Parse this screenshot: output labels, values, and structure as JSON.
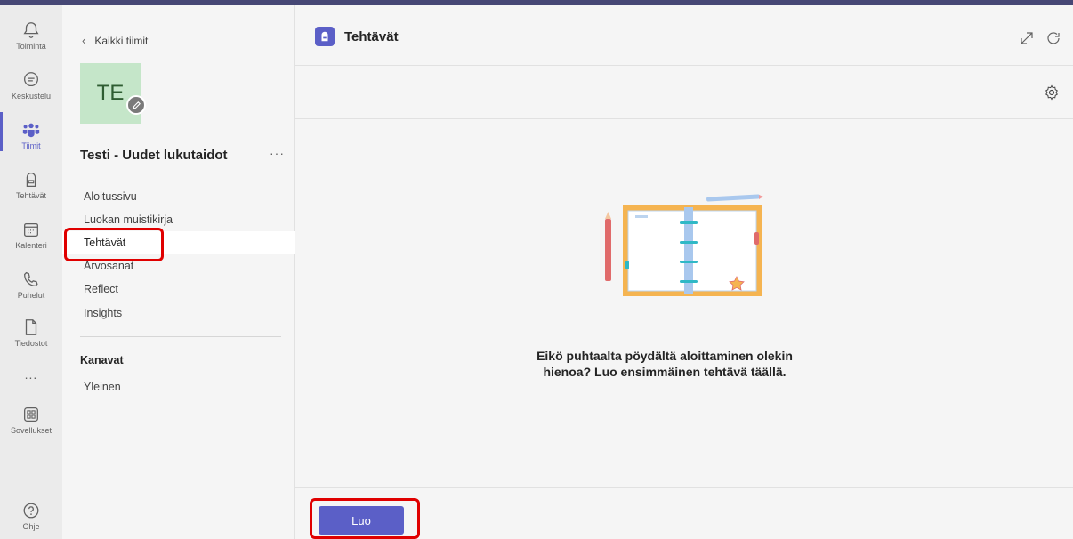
{
  "rail": {
    "items": [
      {
        "label": "Toiminta",
        "icon": "bell-icon"
      },
      {
        "label": "Keskustelu",
        "icon": "chat-icon"
      },
      {
        "label": "Tiimit",
        "icon": "teams-icon"
      },
      {
        "label": "Tehtävät",
        "icon": "backpack-icon"
      },
      {
        "label": "Kalenteri",
        "icon": "calendar-icon"
      },
      {
        "label": "Puhelut",
        "icon": "phone-icon"
      },
      {
        "label": "Tiedostot",
        "icon": "file-icon"
      },
      {
        "label": "...",
        "icon": "more-icon"
      },
      {
        "label": "Sovellukset",
        "icon": "apps-icon"
      }
    ],
    "help_label": "Ohje",
    "active_color": "#5b5fc7"
  },
  "panel": {
    "back_label": "Kaikki tiimit",
    "avatar_initials": "TE",
    "avatar_color": "#c5e6c9",
    "team_name": "Testi - Uudet lukutaidot",
    "more_label": "···",
    "nav": [
      {
        "label": "Aloitussivu"
      },
      {
        "label": "Luokan muistikirja"
      },
      {
        "label": "Tehtävät",
        "selected": true
      },
      {
        "label": "Arvosanat"
      },
      {
        "label": "Reflect"
      },
      {
        "label": "Insights"
      }
    ],
    "channels_title": "Kanavat",
    "channels": [
      {
        "label": "Yleinen"
      }
    ]
  },
  "main": {
    "title": "Tehtävät",
    "empty_message": "Eikö puhtaalta pöydältä aloittaminen olekin hienoa? Luo ensimmäinen tehtävä täällä.",
    "create_button": "Luo",
    "brand_color": "#5b5fc7"
  },
  "highlight_color": "#e00000"
}
